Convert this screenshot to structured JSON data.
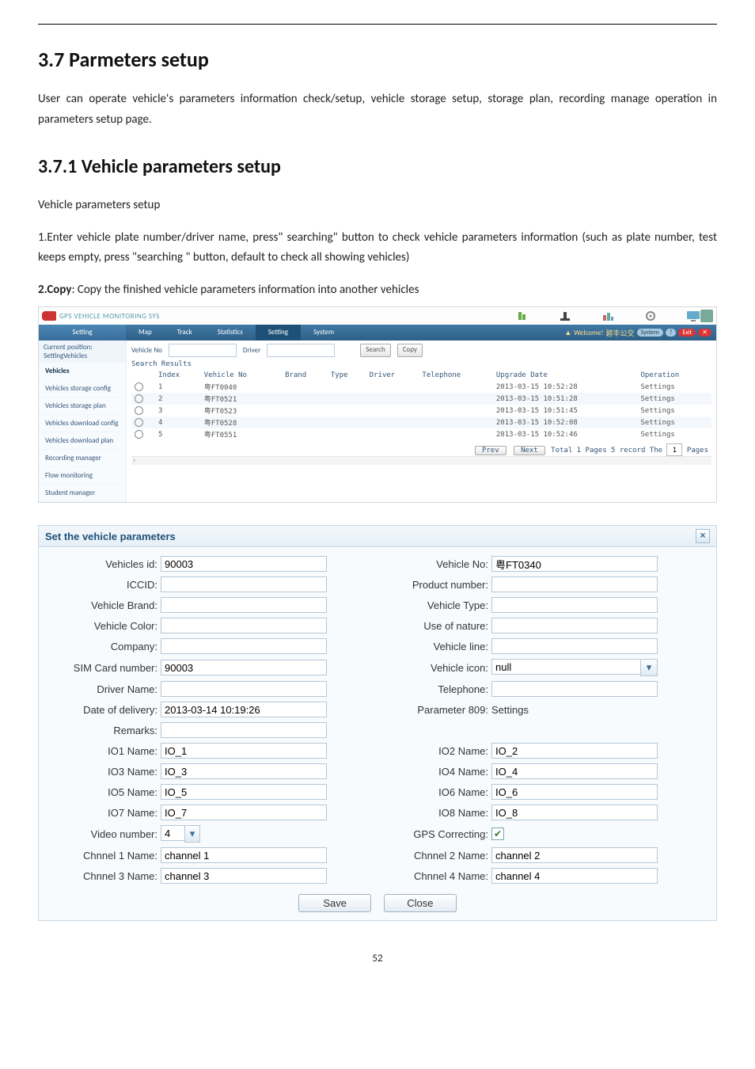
{
  "doc": {
    "h2": "3.7 Parmeters setup",
    "intro": "User can operate vehicle's parameters information check/setup, vehicle storage setup, storage plan, recording manage operation in parameters setup page.",
    "h3": "3.7.1 Vehicle parameters setup",
    "sub1": "Vehicle parameters setup",
    "sub2": "1.Enter vehicle plate number/driver name, press\" searching\" button to check vehicle parameters information (such as plate number, test keeps empty, press \"searching \" button, default to check all showing vehicles)",
    "copy_bold": "2.Copy",
    "copy_rest": ": Copy the finished vehicle parameters information into another vehicles",
    "page_number": "52"
  },
  "shot1": {
    "product": "GPS VEHICLE MONITORING SYS",
    "nav": {
      "sidehead": "Setting",
      "items": [
        "Map",
        "Track",
        "Statistics",
        "Setting",
        "System"
      ],
      "active_index": 3
    },
    "welcome_prefix": "Welcome!",
    "welcome_company": "碧丰公交",
    "welcome_system": "System",
    "welcome_exit": "Exit",
    "crumb": "Current position: SettingVehicles",
    "sidebar": [
      "Vehicles",
      "Vehicles storage config",
      "Vehicles storage plan",
      "Vehicles download config",
      "Vehicles download plan",
      "Recording manager",
      "Flow monitoring",
      "Student manager"
    ],
    "sidebar_active": 0,
    "search": {
      "vehicle_label": "Vehicle No",
      "driver_label": "Driver",
      "search_btn": "Search",
      "copy_btn": "Copy"
    },
    "results_title": "Search Results",
    "columns": [
      "Index",
      "Vehicle No",
      "Brand",
      "Type",
      "Driver",
      "Telephone",
      "Upgrade Date",
      "Operation"
    ],
    "rows": [
      {
        "idx": "1",
        "vno": "粤FT0040",
        "date": "2013-03-15 10:52:28",
        "op": "Settings"
      },
      {
        "idx": "2",
        "vno": "粤FT0521",
        "date": "2013-03-15 10:51:28",
        "op": "Settings"
      },
      {
        "idx": "3",
        "vno": "粤FT0523",
        "date": "2013-03-15 10:51:45",
        "op": "Settings"
      },
      {
        "idx": "4",
        "vno": "粤FT0528",
        "date": "2013-03-15 10:52:08",
        "op": "Settings"
      },
      {
        "idx": "5",
        "vno": "粤FT0551",
        "date": "2013-03-15 10:52:46",
        "op": "Settings"
      }
    ],
    "pager": {
      "prev": "Prev",
      "next": "Next",
      "summary": "Total 1 Pages 5 record The",
      "page_val": "1",
      "suffix": "Pages"
    }
  },
  "dialog": {
    "title": "Set the vehicle parameters",
    "left_labels": {
      "vehicles_id": "Vehicles id:",
      "iccid": "ICCID:",
      "brand": "Vehicle Brand:",
      "color": "Vehicle Color:",
      "company": "Company:",
      "sim": "SIM Card number:",
      "driver": "Driver Name:",
      "delivery": "Date of delivery:",
      "remarks": "Remarks:",
      "io1": "IO1 Name:",
      "io3": "IO3 Name:",
      "io5": "IO5 Name:",
      "io7": "IO7 Name:",
      "video": "Video number:",
      "ch1": "Chnnel 1 Name:",
      "ch3": "Chnnel 3 Name:"
    },
    "right_labels": {
      "vehicle_no": "Vehicle No:",
      "product_no": "Product number:",
      "vtype": "Vehicle Type:",
      "use": "Use of nature:",
      "line": "Vehicle line:",
      "icon": "Vehicle icon:",
      "tel": "Telephone:",
      "param809": "Parameter 809:",
      "io2": "IO2 Name:",
      "io4": "IO4 Name:",
      "io6": "IO6 Name:",
      "io8": "IO8 Name:",
      "gps": "GPS Correcting:",
      "ch2": "Chnnel 2 Name:",
      "ch4": "Chnnel 4 Name:"
    },
    "values": {
      "vehicles_id": "90003",
      "vehicle_no": "粤FT0340",
      "sim": "90003",
      "icon": "null",
      "delivery": "2013-03-14 10:19:26",
      "param809": "Settings",
      "io1": "IO_1",
      "io2": "IO_2",
      "io3": "IO_3",
      "io4": "IO_4",
      "io5": "IO_5",
      "io6": "IO_6",
      "io7": "IO_7",
      "io8": "IO_8",
      "video": "4",
      "ch1": "channel 1",
      "ch2": "channel 2",
      "ch3": "channel 3",
      "ch4": "channel 4"
    },
    "buttons": {
      "save": "Save",
      "close": "Close"
    }
  }
}
